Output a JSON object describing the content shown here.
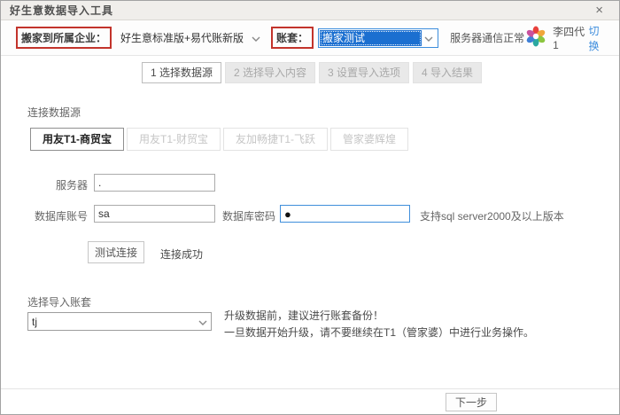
{
  "title": "好生意数据导入工具",
  "icons": {
    "close": "×"
  },
  "colors": {
    "accent_blue": "#1b6fd0",
    "highlight_red": "#c2332b",
    "link_blue": "#3e8ddd",
    "focus_border": "#3f8fdb"
  },
  "header": {
    "migrate_label": "搬家到所属企业：",
    "product_value": "好生意标准版+易代账新版",
    "account_label": "账套：",
    "account_value": "搬家测试",
    "server_status": "服务器通信正常",
    "user_name": "李四代1",
    "switch_label": "切换"
  },
  "steps": [
    {
      "label": "1 选择数据源",
      "active": true
    },
    {
      "label": "2 选择导入内容",
      "active": false
    },
    {
      "label": "3 设置导入选项",
      "active": false
    },
    {
      "label": "4 导入结果",
      "active": false
    }
  ],
  "source_section": {
    "title": "连接数据源",
    "tabs": [
      {
        "label": "用友T1-商贸宝",
        "active": true
      },
      {
        "label": "用友T1-财贸宝",
        "active": false
      },
      {
        "label": "友加畅捷T1-飞跃",
        "active": false
      },
      {
        "label": "管家婆辉煌",
        "active": false
      }
    ],
    "server_label": "服务器",
    "server_value": ".",
    "db_user_label": "数据库账号",
    "db_user_value": "sa",
    "db_pass_label": "数据库密码",
    "db_pass_value": "●",
    "support_note": "支持sql server2000及以上版本",
    "test_button": "测试连接",
    "test_result": "连接成功"
  },
  "import_section": {
    "title": "选择导入账套",
    "account_value": "tj",
    "note_line1": "升级数据前，建议进行账套备份！",
    "note_line2": "一旦数据开始升级，请不要继续在T1（管家婆）中进行业务操作。"
  },
  "footer": {
    "next_button": "下一步"
  }
}
